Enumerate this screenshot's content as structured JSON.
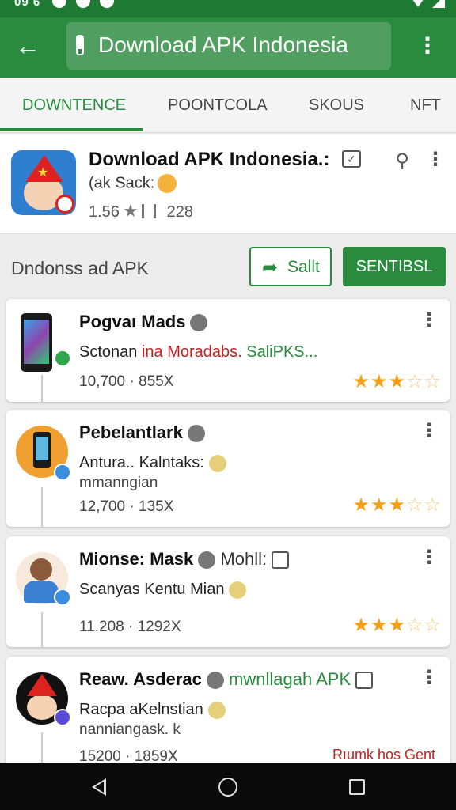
{
  "status_bar": {
    "time": "09 6"
  },
  "toolbar": {
    "title": "Download APK Indonesia"
  },
  "tabs": [
    {
      "label": "DOWNTENCE",
      "active": true
    },
    {
      "label": "POONTCOLA",
      "active": false
    },
    {
      "label": "SKOUS",
      "active": false
    },
    {
      "label": "NFT",
      "active": false
    }
  ],
  "app": {
    "name": "Download APK Indonesia.:",
    "subtitle": "(ak Sack:",
    "rating": "1.56",
    "count": "228"
  },
  "section": {
    "label": "Dndonss ad APK",
    "share_button": "Sallt",
    "primary_button": "SENTIBSL"
  },
  "items": [
    {
      "title": "Pogvaı Mads",
      "line2_a": "Sctonan ",
      "line2_b": "ina Moradabs.",
      "line2_c": " SaliPKS...",
      "meta": "10,700 · 855X",
      "rating": 3.5
    },
    {
      "title": "Pebelantlark",
      "line2": "Antura.. Kalntaks:",
      "line3": "mmanngian",
      "meta": "12,700 · 135X",
      "rating": 3.5
    },
    {
      "title": "Mionse: Mask",
      "title_extra": "Mohll:",
      "line2": "Scanyas Kentu Mian",
      "meta": "11.208 · 1292X",
      "rating": 3.5
    },
    {
      "title": "Reaw. Asderac",
      "title_extra": "mwnllagah APK",
      "line2": "Racpa aKelnstian",
      "line3": "nanniangask. k",
      "meta": "15200 · 1859X",
      "tag": "Rıumk hos Gent"
    }
  ],
  "colors": {
    "primary": "#2a8a3e",
    "status_bar": "#1e7a33",
    "star": "#f2a01a",
    "accent_red": "#c42020"
  },
  "icons": {
    "toolbar": [
      "back-arrow-icon",
      "microphone-icon",
      "more-vert-icon"
    ],
    "app_header": [
      "calendar-icon",
      "search-icon",
      "more-vert-icon"
    ],
    "nav": [
      "nav-back-icon",
      "nav-home-icon",
      "nav-recents-icon"
    ]
  }
}
